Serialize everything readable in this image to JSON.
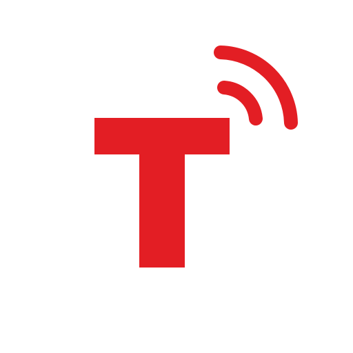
{
  "logo": {
    "letter": "T",
    "icon": "signal-t-logo-icon",
    "signal_icon": "wireless-signal-icon"
  },
  "colors": {
    "brand": "#e31e24",
    "background": "#ffffff"
  }
}
